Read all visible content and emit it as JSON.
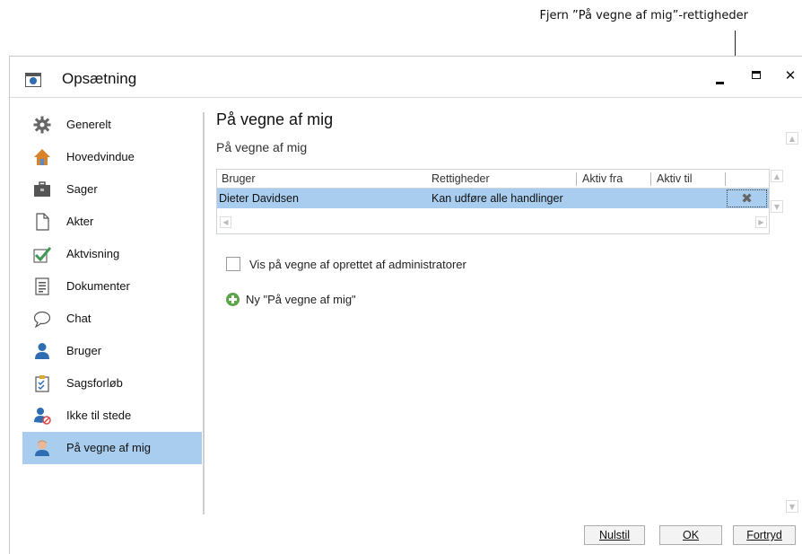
{
  "annotation": {
    "callout": "Fjern ”På vegne af mig”-rettigheder"
  },
  "window": {
    "title": "Opsætning",
    "controls": {
      "minimize": "‒",
      "maximize": "□",
      "close": "✕"
    }
  },
  "sidebar": {
    "items": [
      {
        "label": "Generelt",
        "icon": "gear-icon"
      },
      {
        "label": "Hovedvindue",
        "icon": "home-icon"
      },
      {
        "label": "Sager",
        "icon": "briefcase-icon"
      },
      {
        "label": "Akter",
        "icon": "page-icon"
      },
      {
        "label": "Aktvisning",
        "icon": "checkmark-icon"
      },
      {
        "label": "Dokumenter",
        "icon": "document-icon"
      },
      {
        "label": "Chat",
        "icon": "speech-bubble-icon"
      },
      {
        "label": "Bruger",
        "icon": "user-icon"
      },
      {
        "label": "Sagsforløb",
        "icon": "clipboard-checklist-icon"
      },
      {
        "label": "Ikke til stede",
        "icon": "user-absent-icon"
      },
      {
        "label": "På vegne af mig",
        "icon": "user-avatar-icon",
        "selected": true
      }
    ]
  },
  "main": {
    "title": "På vegne af mig",
    "section_title": "På vegne af mig",
    "grid": {
      "columns": [
        "Bruger",
        "Rettigheder",
        "Aktiv fra",
        "Aktiv til"
      ],
      "rows": [
        {
          "bruger": "Dieter Davidsen",
          "rettigheder": "Kan udføre alle handlinger",
          "aktiv_fra": "",
          "aktiv_til": "",
          "remove": "✖"
        }
      ]
    },
    "checkbox_label": "Vis på vegne af oprettet af administratorer",
    "new_link": "Ny \"På vegne af mig\""
  },
  "footer": {
    "reset": "Nulstil",
    "ok": "OK",
    "cancel": "Fortryd"
  }
}
